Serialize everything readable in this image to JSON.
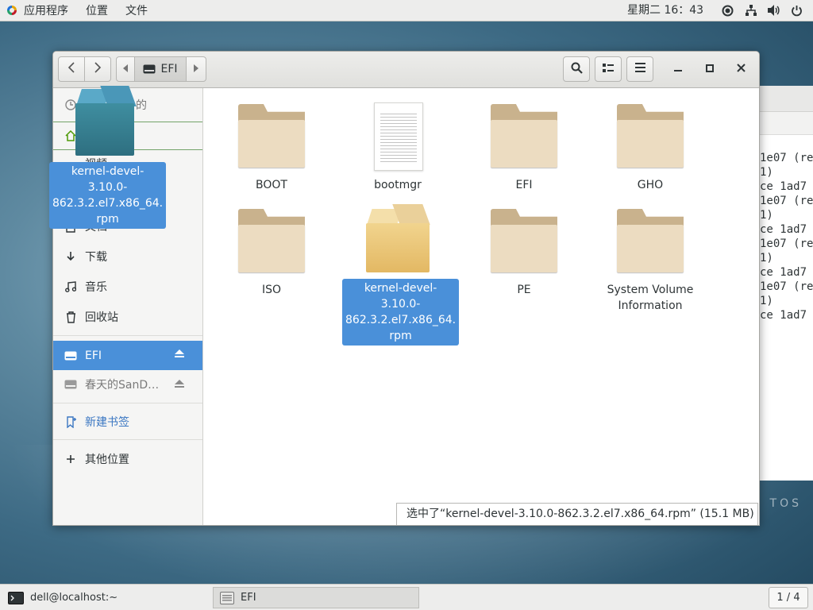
{
  "topbar": {
    "applications": "应用程序",
    "places": "位置",
    "files": "文件",
    "clock": "星期二 16：43"
  },
  "window": {
    "path_current": "EFI",
    "sidebar": {
      "recent_partial": "的",
      "videos_partial": "视频",
      "documents": "文档",
      "downloads": "下载",
      "music": "音乐",
      "trash": "回收站",
      "efi_drive": "EFI",
      "sandisk_drive": "春天的SanD…",
      "new_bookmark": "新建书签",
      "other_locations": "其他位置"
    },
    "items": [
      {
        "name": "BOOT",
        "kind": "folder"
      },
      {
        "name": "bootmgr",
        "kind": "file"
      },
      {
        "name": "EFI",
        "kind": "folder"
      },
      {
        "name": "GHO",
        "kind": "folder"
      },
      {
        "name": "ISO",
        "kind": "folder"
      },
      {
        "name": "kernel-devel-3.10.0-862.3.2.el7.x86_64.rpm",
        "label_line1": "kernel-devel-3.10.0-",
        "label_line2": "862.3.2.el7.x86_64.",
        "label_line3": "rpm",
        "kind": "package",
        "selected": true
      },
      {
        "name": "PE",
        "kind": "folder"
      },
      {
        "name": "System Volume Information",
        "label_line1": "System Volume",
        "label_line2": "Information",
        "kind": "folder"
      }
    ],
    "status": "选中了“kernel-devel-3.10.0-862.3.2.el7.x86_64.rpm” (15.1 MB)"
  },
  "drag_ghost": {
    "line1": "kernel-devel-3.10.0-",
    "line2": "862.3.2.el7.x86_64.",
    "line3": "rpm"
  },
  "terminal": {
    "lines": [
      "1e07 (re",
      "",
      "1)",
      "ce 1ad7",
      "1e07 (re",
      "",
      "1)",
      "ce 1ad7",
      "1e07 (re",
      "",
      "1)",
      "ce 1ad7",
      "1e07 (re",
      "",
      "1)",
      "ce 1ad7"
    ]
  },
  "desktop": {
    "brand_partial": "TOS"
  },
  "taskbar": {
    "terminal_task": "dell@localhost:~",
    "files_task": "EFI",
    "workspace": "1 / 4"
  },
  "colors": {
    "selection": "#4a90d9",
    "folder_front": "#ecdcc1",
    "folder_back": "#c9b28d"
  }
}
